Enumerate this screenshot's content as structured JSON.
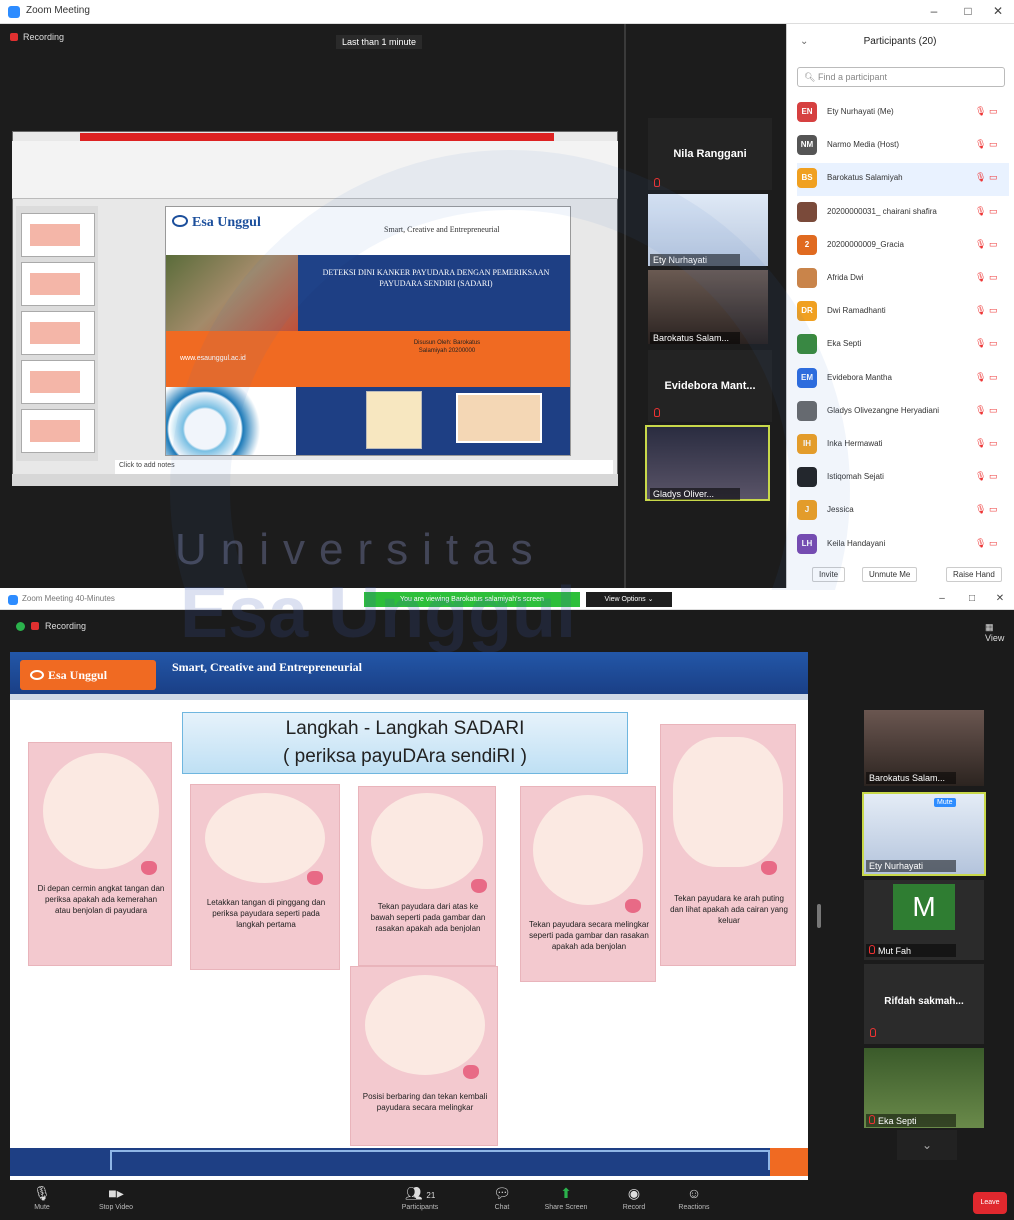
{
  "top_window": {
    "title": "Zoom Meeting",
    "recording": "Recording",
    "talking": "Last than 1 minute",
    "ppt_notes": "Click to add notes",
    "slide": {
      "logo": "Esa Unggul",
      "tagline": "Smart, Creative and Entrepreneurial",
      "title": "DETEKSI DINI KANKER PAYUDARA DENGAN PEMERIKSAAN PAYUDARA SENDIRI (SADARI)",
      "url": "www.esaunggul.ac.id",
      "author": "Disusun Oleh: Barokatus Salamiyah 20200000"
    },
    "video_tiles": [
      {
        "name": "Nila Ranggani",
        "style": "name_only"
      },
      {
        "name": "Ety Nurhayati",
        "style": "video"
      },
      {
        "name": "Barokatus Salam...",
        "style": "video"
      },
      {
        "name": "Evidebora Mant...",
        "style": "name_only"
      },
      {
        "name": "Gladys Oliver...",
        "style": "video"
      }
    ]
  },
  "participants_panel": {
    "title": "Participants (20)",
    "search_placeholder": "Find a participant",
    "participants": [
      {
        "initials": "EN",
        "name": "Ety Nurhayati (Me)",
        "color": "#d64040"
      },
      {
        "initials": "NM",
        "name": "Narmo Media (Host)",
        "color": "#555555"
      },
      {
        "initials": "BS",
        "name": "Barokatus Salamiyah",
        "color": "#f0a020"
      },
      {
        "initials": "",
        "name": "20200000031_ chairani shafira",
        "color": "#7a4a3a"
      },
      {
        "initials": "2",
        "name": "20200000009_Gracia",
        "color": "#e06a20"
      },
      {
        "initials": "",
        "name": "Afrida Dwi",
        "color": "#c9844a"
      },
      {
        "initials": "DR",
        "name": "Dwi Ramadhanti",
        "color": "#f0a020"
      },
      {
        "initials": "",
        "name": "Eka Septi",
        "color": "#3a8a3a"
      },
      {
        "initials": "EM",
        "name": "Evidebora Mantha",
        "color": "#2d6cdf"
      },
      {
        "initials": "",
        "name": "Gladys Olivezangne Heryadiani",
        "color": "#6a6a6a"
      },
      {
        "initials": "IH",
        "name": "Inka Hermawati",
        "color": "#f0a020"
      },
      {
        "initials": "",
        "name": "Istiqomah Sejati",
        "color": "#222222"
      },
      {
        "initials": "J",
        "name": "Jessica",
        "color": "#f0a020"
      },
      {
        "initials": "LH",
        "name": "Keila Handayani",
        "color": "#7a4ab0"
      }
    ],
    "buttons": [
      "Invite",
      "Unmute Me",
      "Raise Hand"
    ]
  },
  "bottom_window": {
    "title": "Zoom Meeting 40-Minutes",
    "banner": "You are viewing Barokatus salamiyah's screen",
    "view_options": "View Options",
    "recording": "Recording",
    "view": "View",
    "slide": {
      "logo": "Esa Unggul",
      "tagline": "Smart, Creative and Entrepreneurial",
      "title_line1": "Langkah - Langkah SADARI",
      "title_line2": "( periksa payuDAra sendiRI )",
      "steps": [
        "Di depan cermin angkat tangan dan periksa apakah ada kemerahan atau benjolan di payudara",
        "Letakkan tangan di pinggang dan periksa payudara seperti pada langkah pertama",
        "Tekan payudara dari atas ke bawah seperti pada gambar dan rasakan apakah ada benjolan",
        "Tekan payudara secara melingkar seperti pada gambar dan rasakan apakah ada benjolan",
        "Tekan payudara ke arah puting dan lihat apakah ada cairan yang keluar",
        "Posisi berbaring dan tekan kembali payudara secara melingkar"
      ]
    },
    "video_tiles": [
      {
        "name": "Barokatus Salam..."
      },
      {
        "name": "Ety Nurhayati",
        "badge": "Mute"
      },
      {
        "name": "Mut Fah",
        "letter": "M"
      },
      {
        "name": "Rifdah sakmah..."
      },
      {
        "name": "Eka Septi"
      }
    ]
  },
  "toolbar": {
    "mute": "Mute",
    "video": "Stop Video",
    "participants": "Participants",
    "participants_count": "21",
    "chat": "Chat",
    "share": "Share Screen",
    "record": "Record",
    "reactions": "Reactions",
    "leave": "Leave"
  },
  "watermark": {
    "line1": "Universitas",
    "line2": "Esa Unggul"
  }
}
